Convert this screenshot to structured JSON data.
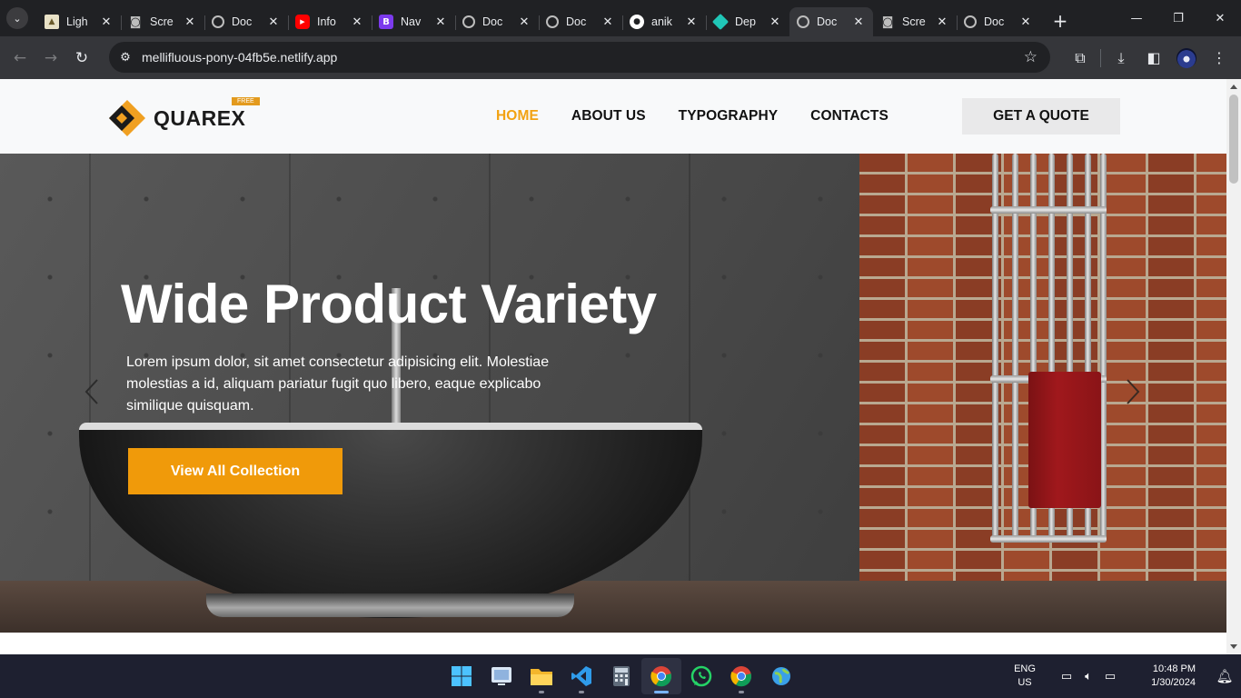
{
  "browser": {
    "tabs": [
      {
        "title": "Ligh",
        "icon": "lighthouse-icon",
        "color": "#9e9e9e"
      },
      {
        "title": "Scre",
        "icon": "camera-icon",
        "color": "#bdbdbd"
      },
      {
        "title": "Doc",
        "icon": "globe-icon",
        "color": "#bdbdbd"
      },
      {
        "title": "Info",
        "icon": "youtube-icon",
        "color": "#ff0000"
      },
      {
        "title": "Nav",
        "icon": "bootstrap-icon",
        "color": "#7c3aed"
      },
      {
        "title": "Doc",
        "icon": "globe-icon",
        "color": "#bdbdbd"
      },
      {
        "title": "Doc",
        "icon": "globe-icon",
        "color": "#bdbdbd"
      },
      {
        "title": "anik",
        "icon": "github-icon",
        "color": "#ffffff"
      },
      {
        "title": "Dep",
        "icon": "netlify-icon",
        "color": "#20c6b7"
      },
      {
        "title": "Doc",
        "icon": "globe-icon",
        "color": "#bdbdbd",
        "active": true
      },
      {
        "title": "Scre",
        "icon": "camera-icon",
        "color": "#bdbdbd"
      },
      {
        "title": "Doc",
        "icon": "globe-icon",
        "color": "#bdbdbd"
      }
    ],
    "url": "mellifluous-pony-04fb5e.netlify.app"
  },
  "site": {
    "logo_text": "QUAREX",
    "logo_badge": "FREE",
    "nav": {
      "home": "HOME",
      "about": "ABOUT US",
      "typography": "TYPOGRAPHY",
      "contacts": "CONTACTS"
    },
    "quote_button": "GET A QUOTE",
    "accent_color": "#f09a0a"
  },
  "hero": {
    "title": "Wide Product Variety",
    "text": "Lorem ipsum dolor, sit amet consectetur adipisicing elit. Molestiae molestias a id, aliquam pariatur fugit quo libero, eaque explicabo similique quisquam.",
    "cta": "View All Collection"
  },
  "taskbar": {
    "apps": [
      "windows-start-icon",
      "screen-viewer-icon",
      "file-explorer-icon",
      "vscode-icon",
      "calculator-icon",
      "chrome-icon",
      "whatsapp-icon",
      "chrome-icon",
      "maps-icon"
    ],
    "lang_line1": "ENG",
    "lang_line2": "US",
    "time": "10:48 PM",
    "date": "1/30/2024"
  }
}
